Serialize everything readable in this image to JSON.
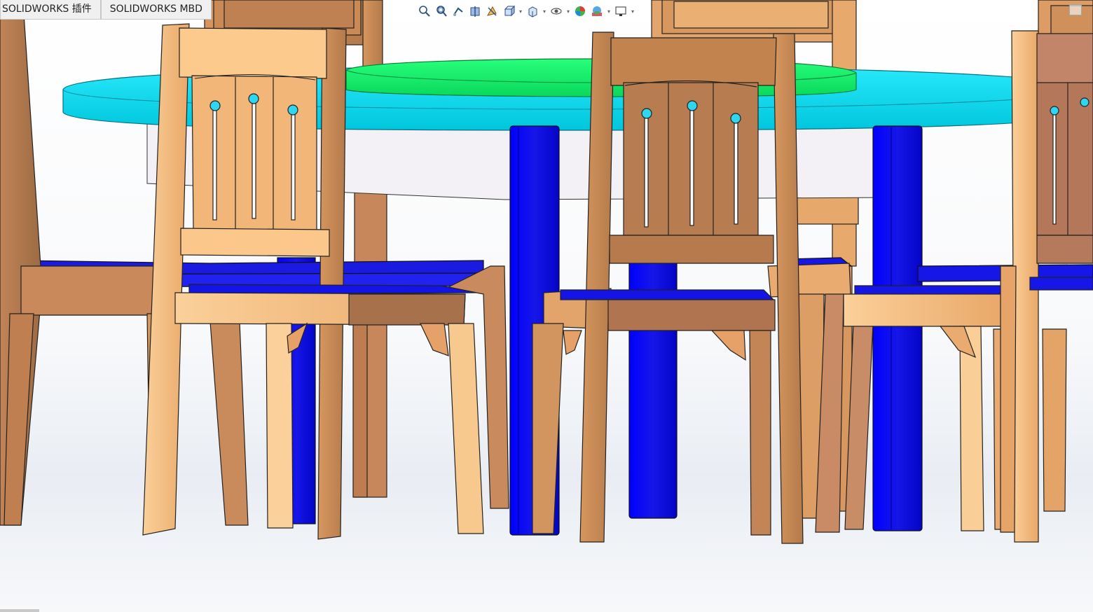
{
  "tabs": [
    {
      "label": "SOLIDWORKS 插件"
    },
    {
      "label": "SOLIDWORKS MBD"
    }
  ],
  "view_toolbar": {
    "icons": [
      "zoom-to-fit-icon",
      "zoom-to-area-icon",
      "previous-view-icon",
      "section-view-icon",
      "dynamic-annotation-icon",
      "view-orientation-icon",
      "display-style-icon",
      "hide-show-icon",
      "edit-appearance-icon",
      "apply-scene-icon",
      "view-settings-icon"
    ]
  },
  "colors": {
    "wood_light": "#f6c283",
    "wood_mid": "#e0a064",
    "wood_dark": "#b4784a",
    "seat_blue": "#1414e6",
    "leg_blue": "#0a0ae8",
    "table_cyan": "#00e6f7",
    "table_green": "#12f06a"
  }
}
